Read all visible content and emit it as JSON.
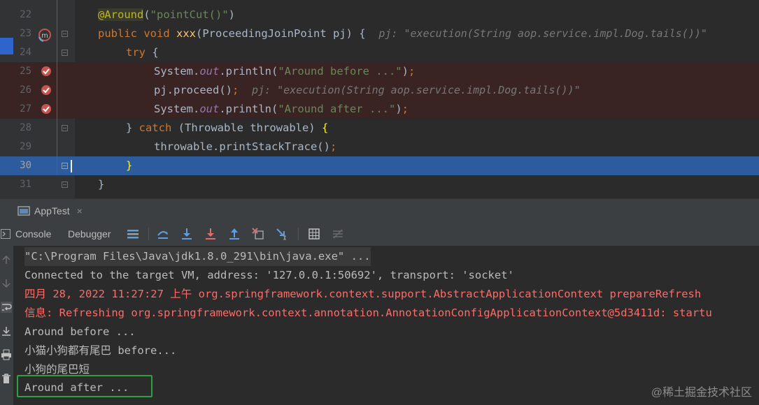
{
  "editor": {
    "lines": [
      {
        "num": "22"
      },
      {
        "num": "23"
      },
      {
        "num": "24"
      },
      {
        "num": "25"
      },
      {
        "num": "26"
      },
      {
        "num": "27"
      },
      {
        "num": "28"
      },
      {
        "num": "29"
      },
      {
        "num": "30"
      },
      {
        "num": "31"
      }
    ],
    "code": {
      "l22_ann": "@Around",
      "l22_paren_open": "(",
      "l22_str": "\"pointCut()\"",
      "l22_paren_close": ")",
      "l23_kw1": "public",
      "l23_kw2": "void",
      "l23_fn": "xxx",
      "l23_rest": "(ProceedingJoinPoint pj) {",
      "l23_hint": "pj: \"execution(String aop.service.impl.Dog.tails())\"",
      "l24_kw": "try",
      "l24_rest": " {",
      "l25_a": "System.",
      "l25_fld": "out",
      "l25_b": ".println(",
      "l25_str": "\"Around before ...\"",
      "l25_c": ")",
      "l25_semi": ";",
      "l26_a": "pj.proceed()",
      "l26_semi": ";",
      "l26_hint": "pj: \"execution(String aop.service.impl.Dog.tails())\"",
      "l27_a": "System.",
      "l27_fld": "out",
      "l27_b": ".println(",
      "l27_str": "\"Around after ...\"",
      "l27_c": ")",
      "l27_semi": ";",
      "l28_a": "} ",
      "l28_kw": "catch",
      "l28_b": " (Throwable throwable) ",
      "l28_brace": "{",
      "l29_a": "throwable.printStackTrace()",
      "l29_semi": ";",
      "l30_brace": "}",
      "l31_brace": "}"
    }
  },
  "run_window": {
    "tab_label": "AppTest",
    "close_glyph": "×",
    "console_tab": "Console",
    "debugger_tab": "Debugger"
  },
  "console": {
    "lines": [
      "\"C:\\Program Files\\Java\\jdk1.8.0_291\\bin\\java.exe\" ...",
      "Connected to the target VM, address: '127.0.0.1:50692', transport: 'socket'",
      "四月 28, 2022 11:27:27 上午 org.springframework.context.support.AbstractApplicationContext prepareRefresh",
      "信息: Refreshing org.springframework.context.annotation.AnnotationConfigApplicationContext@5d3411d: startu",
      "Around before ...",
      "小猫小狗都有尾巴 before...",
      "小狗的尾巴短",
      "Around after ..."
    ],
    "watermark": "@稀土掘金技术社区"
  },
  "colors": {
    "breakpoint": "#c75450",
    "highlight_box": "#2ea043",
    "selection": "#2d5c9e",
    "error_text": "#ff6b68"
  },
  "icons": [
    "breakpoint-icon",
    "method-override-icon",
    "fold-icon",
    "console-icon",
    "debugger-icon",
    "step-over-icon",
    "step-into-icon",
    "force-step-into-icon",
    "step-out-icon",
    "drop-frame-icon",
    "run-to-cursor-icon",
    "evaluate-icon",
    "trace-icon",
    "soft-wrap-icon",
    "scroll-end-icon",
    "print-icon",
    "trash-icon",
    "up-arrow-icon",
    "down-arrow-icon"
  ]
}
